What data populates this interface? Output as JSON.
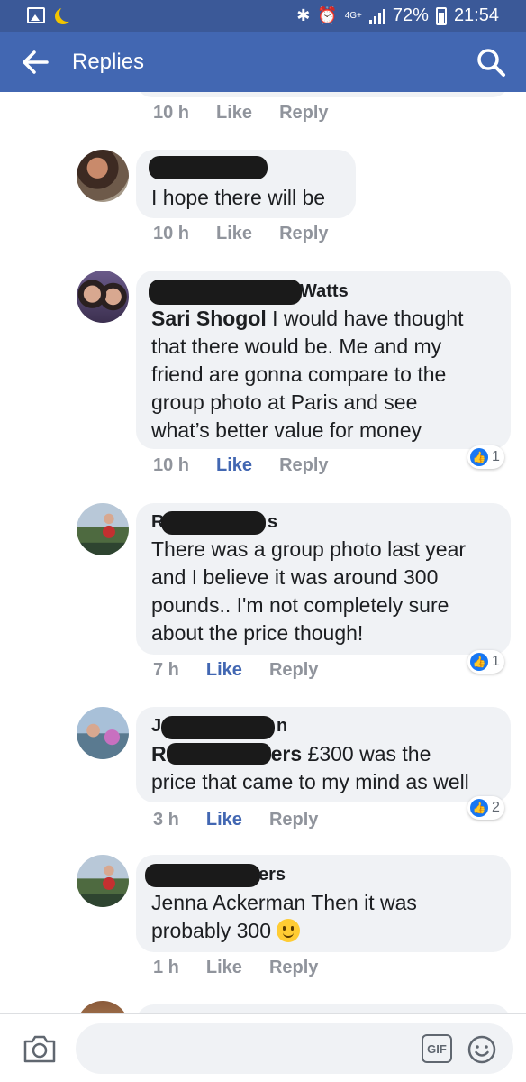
{
  "status_bar": {
    "network": "4G+",
    "battery": "72%",
    "time": "21:54"
  },
  "app_bar": {
    "title": "Replies"
  },
  "comments": [
    {
      "time": "10 h",
      "like_label": "Like",
      "reply_label": "Reply"
    },
    {
      "name_visible": "",
      "text": "I hope there will be",
      "time": "10 h",
      "like_label": "Like",
      "reply_label": "Reply"
    },
    {
      "name_visible": "Watts",
      "mention": "Sari Shogol",
      "text_lines": [
        " I would have thought",
        "that there would be. Me and my",
        "friend are gonna compare to the",
        "group photo at Paris and see",
        "what’s better value for money"
      ],
      "time": "10 h",
      "like_label": "Like",
      "reply_label": "Reply",
      "liked": true,
      "reaction_count": "1"
    },
    {
      "name_visible_start": "R",
      "name_visible_end": "s",
      "text_lines": [
        "There was a group photo last year",
        "and I believe it was around 300",
        "pounds.. I'm not completely sure",
        "about the price though!"
      ],
      "time": "7 h",
      "like_label": "Like",
      "reply_label": "Reply",
      "liked": true,
      "reaction_count": "1"
    },
    {
      "name_visible_start": "J",
      "name_visible_end": "n",
      "mention_start": "R",
      "mention_end": "ers",
      "text_lines": [
        " £300 was the",
        "price that came to my mind as well"
      ],
      "time": "3 h",
      "like_label": "Like",
      "reply_label": "Reply",
      "liked": true,
      "reaction_count": "2"
    },
    {
      "name_visible_end": "ers",
      "text_lines": [
        "Jenna Ackerman Then it was",
        "probably 300 "
      ],
      "time": "1 h",
      "like_label": "Like",
      "reply_label": "Reply"
    }
  ],
  "composer": {
    "placeholder": "",
    "gif_label": "GIF"
  },
  "colors": {
    "status_bar": "#3b5998",
    "app_bar": "#4267b2",
    "bubble": "#f0f2f5",
    "like_active": "#4267b2",
    "meta_text": "#90949c"
  },
  "icons": [
    "image-icon",
    "moon-icon",
    "bluetooth-icon",
    "alarm-icon",
    "signal-icon",
    "battery-icon",
    "back-arrow-icon",
    "search-icon",
    "thumbs-up-icon",
    "smiley-emoji-icon",
    "camera-icon",
    "gif-icon",
    "emoji-icon"
  ]
}
